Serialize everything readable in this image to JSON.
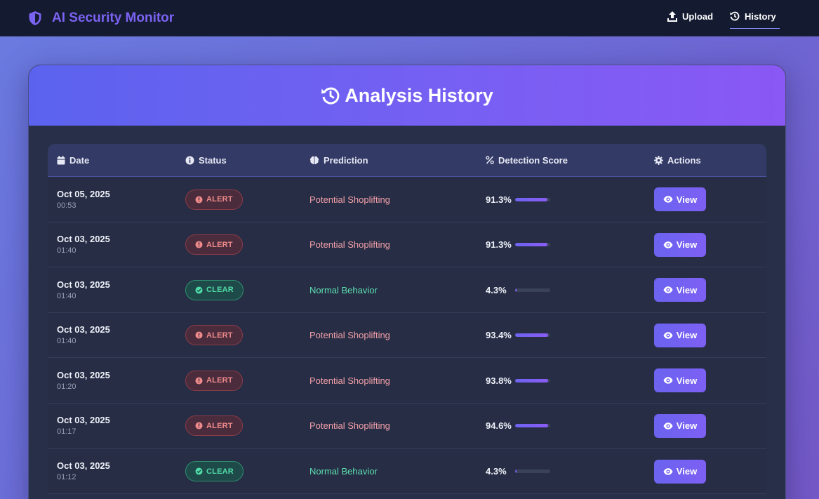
{
  "app": {
    "title": "AI Security Monitor"
  },
  "nav": {
    "upload": "Upload",
    "history": "History"
  },
  "page": {
    "title": "Analysis History"
  },
  "table": {
    "headers": {
      "date": "Date",
      "status": "Status",
      "prediction": "Prediction",
      "score": "Detection Score",
      "actions": "Actions"
    },
    "action_label": "View",
    "rows": [
      {
        "date": "Oct 05, 2025",
        "time": "00:53",
        "status": "ALERT",
        "prediction": "Potential Shoplifting",
        "score": "91.3%",
        "score_value": 0.913
      },
      {
        "date": "Oct 03, 2025",
        "time": "01:40",
        "status": "ALERT",
        "prediction": "Potential Shoplifting",
        "score": "91.3%",
        "score_value": 0.913
      },
      {
        "date": "Oct 03, 2025",
        "time": "01:40",
        "status": "CLEAR",
        "prediction": "Normal Behavior",
        "score": "4.3%",
        "score_value": 0.043
      },
      {
        "date": "Oct 03, 2025",
        "time": "01:40",
        "status": "ALERT",
        "prediction": "Potential Shoplifting",
        "score": "93.4%",
        "score_value": 0.934
      },
      {
        "date": "Oct 03, 2025",
        "time": "01:20",
        "status": "ALERT",
        "prediction": "Potential Shoplifting",
        "score": "93.8%",
        "score_value": 0.938
      },
      {
        "date": "Oct 03, 2025",
        "time": "01:17",
        "status": "ALERT",
        "prediction": "Potential Shoplifting",
        "score": "94.6%",
        "score_value": 0.946
      },
      {
        "date": "Oct 03, 2025",
        "time": "01:12",
        "status": "CLEAR",
        "prediction": "Normal Behavior",
        "score": "4.3%",
        "score_value": 0.043
      }
    ]
  },
  "colors": {
    "accent": "#7b63f2",
    "alert": "#f08b8b",
    "clear": "#4fdba6",
    "navbar": "#141a30"
  },
  "icons": {
    "brand": "shield-icon",
    "upload": "upload-icon",
    "history": "history-icon",
    "date": "calendar-icon",
    "status": "info-icon",
    "prediction": "brain-icon",
    "score": "percent-icon",
    "actions": "gear-icon",
    "alert": "exclamation-circle-icon",
    "clear": "check-circle-icon",
    "view": "eye-icon"
  }
}
